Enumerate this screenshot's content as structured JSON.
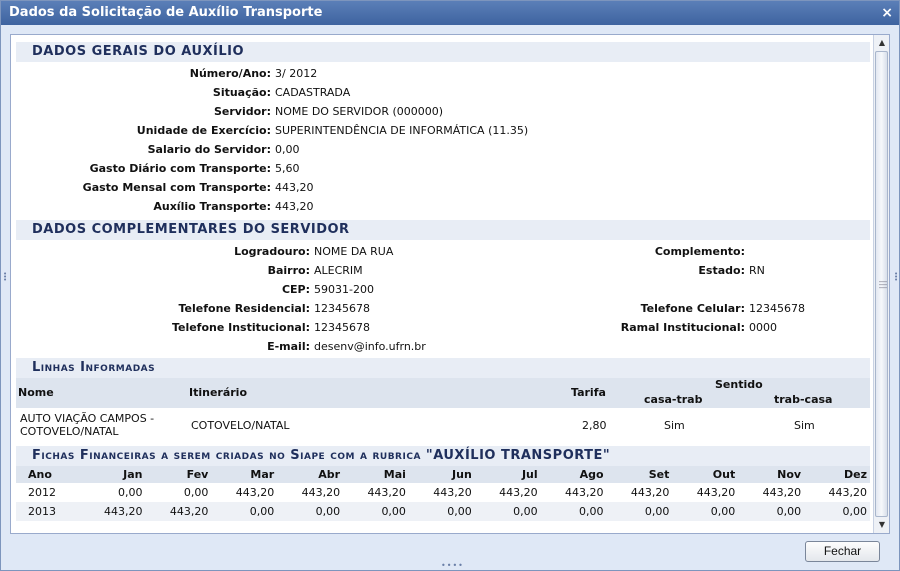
{
  "window": {
    "title": "Dados da Solicitação de Auxílio Transporte",
    "close_glyph": "×"
  },
  "gerais": {
    "title": "DADOS GERAIS DO AUXÍLIO",
    "fields": [
      {
        "label": "Número/Ano:",
        "value": "3/ 2012"
      },
      {
        "label": "Situação:",
        "value": "CADASTRADA"
      },
      {
        "label": "Servidor:",
        "value": "NOME DO SERVIDOR (000000)"
      },
      {
        "label": "Unidade de Exercício:",
        "value": "SUPERINTENDÊNCIA DE INFORMÁTICA (11.35)"
      },
      {
        "label": "Salario do Servidor:",
        "value": "0,00"
      },
      {
        "label": "Gasto Diário com Transporte:",
        "value": "5,60"
      },
      {
        "label": "Gasto Mensal com Transporte:",
        "value": "443,20"
      },
      {
        "label": "Auxílio Transporte:",
        "value": "443,20"
      }
    ]
  },
  "complementares": {
    "title": "DADOS COMPLEMENTARES DO SERVIDOR",
    "left": [
      {
        "label": "Logradouro:",
        "value": "NOME DA RUA"
      },
      {
        "label": "Bairro:",
        "value": "ALECRIM"
      },
      {
        "label": "CEP:",
        "value": "59031-200"
      },
      {
        "label": "Telefone Residencial:",
        "value": "12345678"
      },
      {
        "label": "Telefone Institucional:",
        "value": "12345678"
      },
      {
        "label": "E-mail:",
        "value": "desenv@info.ufrn.br"
      }
    ],
    "right": [
      {
        "label": "Complemento:",
        "value": ""
      },
      {
        "label": "Estado:",
        "value": "RN"
      },
      {
        "label": "",
        "value": ""
      },
      {
        "label": "Telefone Celular:",
        "value": "12345678"
      },
      {
        "label": "Ramal Institucional:",
        "value": "0000"
      }
    ]
  },
  "linhas": {
    "title": "Linhas Informadas",
    "headers": {
      "nome": "Nome",
      "itinerario": "Itinerário",
      "tarifa": "Tarifa",
      "sentido": "Sentido",
      "casa_trab": "casa-trab",
      "trab_casa": "trab-casa"
    },
    "rows": [
      {
        "nome_1": "AUTO VIAÇÃO CAMPOS -",
        "nome_2": "COTOVELO/NATAL",
        "itinerario": "COTOVELO/NATAL",
        "tarifa": "2,80",
        "casa_trab": "Sim",
        "trab_casa": "Sim"
      }
    ]
  },
  "fichas": {
    "title": "Fichas Financeiras a serem criadas no Siape com a rubrica \"AUXÍLIO TRANSPORTE\"",
    "headers": [
      "Ano",
      "Jan",
      "Fev",
      "Mar",
      "Abr",
      "Mai",
      "Jun",
      "Jul",
      "Ago",
      "Set",
      "Out",
      "Nov",
      "Dez"
    ],
    "rows": [
      [
        "2012",
        "0,00",
        "0,00",
        "443,20",
        "443,20",
        "443,20",
        "443,20",
        "443,20",
        "443,20",
        "443,20",
        "443,20",
        "443,20",
        "443,20"
      ],
      [
        "2013",
        "443,20",
        "443,20",
        "0,00",
        "0,00",
        "0,00",
        "0,00",
        "0,00",
        "0,00",
        "0,00",
        "0,00",
        "0,00",
        "0,00"
      ]
    ]
  },
  "footer": {
    "fechar_label": "Fechar"
  }
}
